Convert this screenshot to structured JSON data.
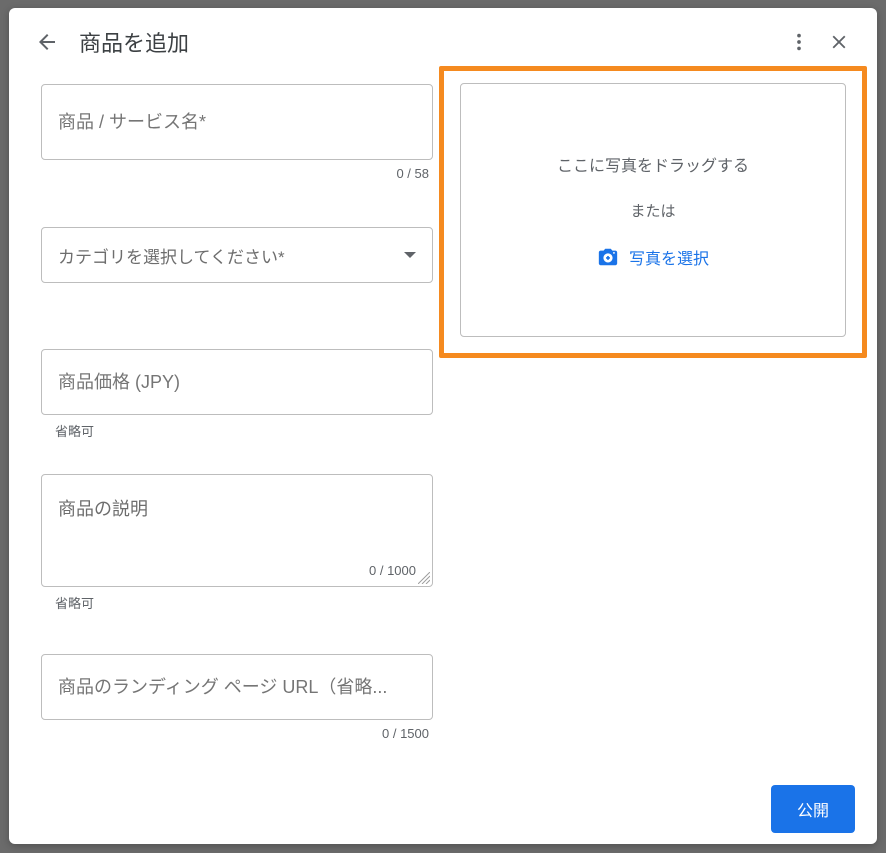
{
  "header": {
    "title": "商品を追加"
  },
  "fields": {
    "product_name_placeholder": "商品 / サービス名*",
    "product_name_counter": "0 / 58",
    "category_placeholder": "カテゴリを選択してください*",
    "price_placeholder": "商品価格 (JPY)",
    "price_helper": "省略可",
    "description_placeholder": "商品の説明",
    "description_counter": "0 / 1000",
    "description_helper": "省略可",
    "url_placeholder": "商品のランディング ページ URL（省略...",
    "url_counter": "0 / 1500"
  },
  "photo": {
    "drag_text": "ここに写真をドラッグする",
    "or_text": "または",
    "select_button": "写真を選択"
  },
  "footer": {
    "publish_button": "公開"
  }
}
